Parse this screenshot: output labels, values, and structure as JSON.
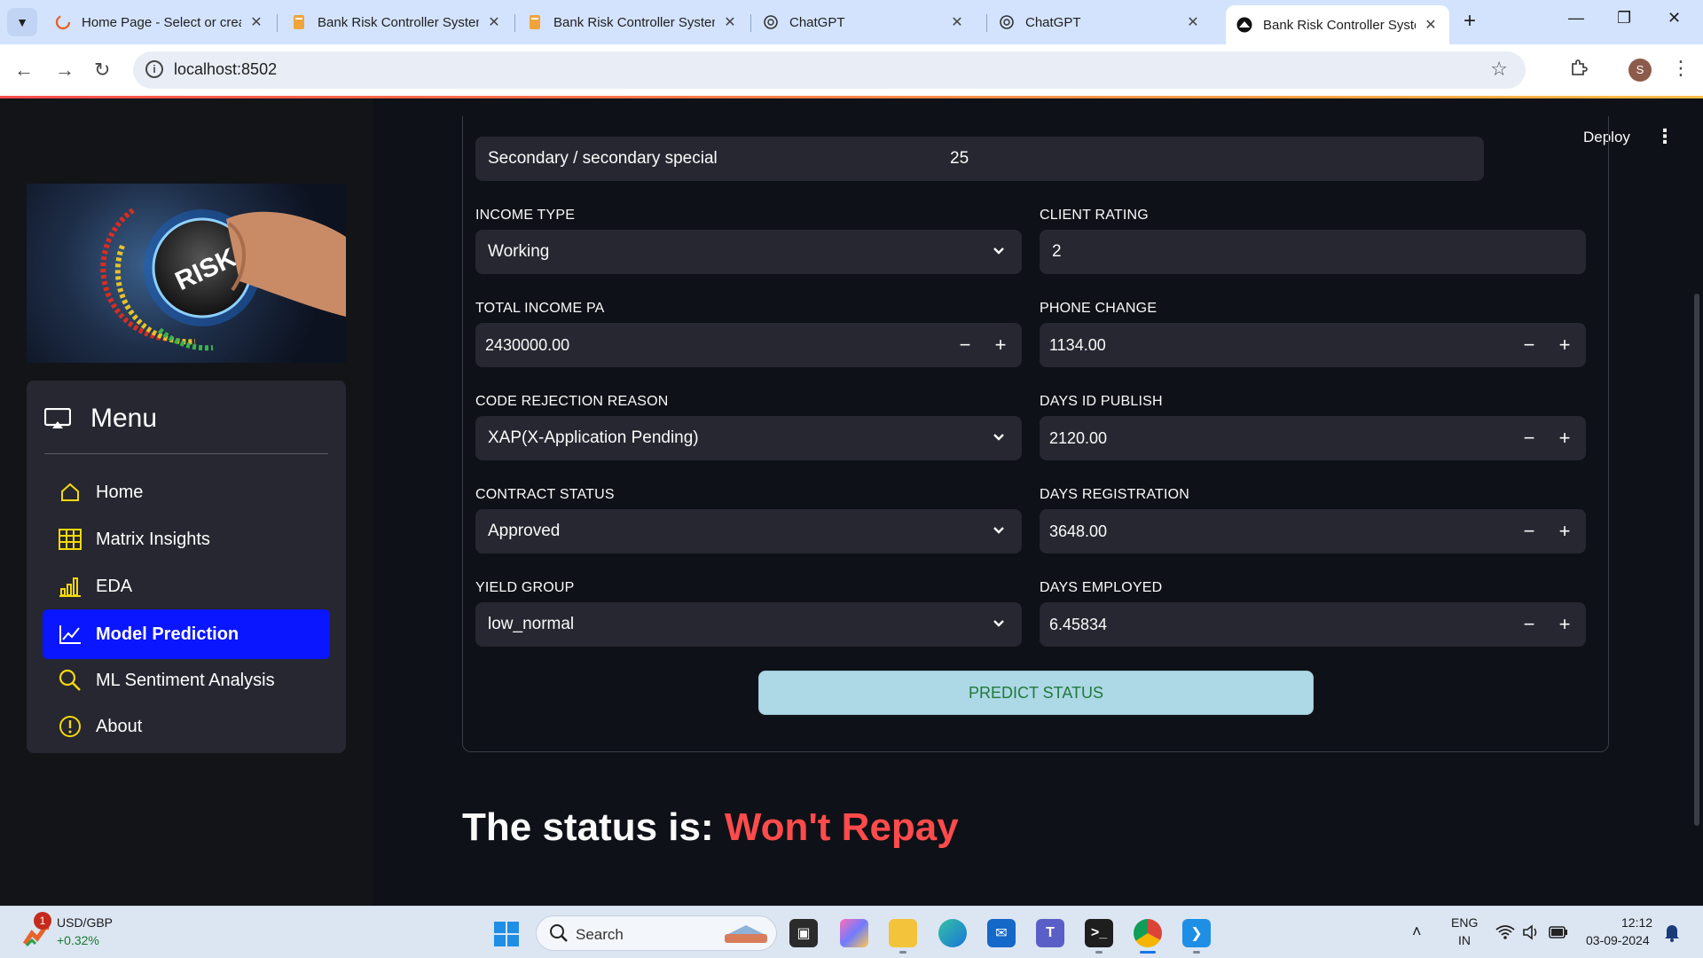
{
  "browser": {
    "tabs": [
      {
        "title": "Home Page - Select or create",
        "favicon": "loading-ring-icon"
      },
      {
        "title": "Bank Risk Controller System",
        "favicon": "notebook-icon"
      },
      {
        "title": "Bank Risk Controller System",
        "favicon": "notebook-icon"
      },
      {
        "title": "ChatGPT",
        "favicon": "openai-icon"
      },
      {
        "title": "ChatGPT",
        "favicon": "openai-icon"
      },
      {
        "title": "Bank Risk Controller System",
        "favicon": "streamlit-icon",
        "active": true
      }
    ],
    "url": "localhost:8502",
    "profile_initial": "S"
  },
  "app": {
    "deploy_label": "Deploy",
    "menu": {
      "title": "Menu",
      "items": [
        {
          "label": "Home",
          "icon": "house-icon"
        },
        {
          "label": "Matrix Insights",
          "icon": "table-grid-icon"
        },
        {
          "label": "EDA",
          "icon": "bar-chart-icon"
        },
        {
          "label": "Model Prediction",
          "icon": "line-chart-icon",
          "active": true
        },
        {
          "label": "ML Sentiment Analysis",
          "icon": "search-icon"
        },
        {
          "label": "About",
          "icon": "exclamation-circle-icon"
        }
      ]
    },
    "form": {
      "education_value": "Secondary / secondary special",
      "age_value": "25",
      "income_type": {
        "label": "INCOME TYPE",
        "value": "Working"
      },
      "client_rating": {
        "label": "CLIENT RATING",
        "value": "2"
      },
      "total_income": {
        "label": "TOTAL INCOME PA",
        "value": "2430000.00"
      },
      "phone_change": {
        "label": "PHONE CHANGE",
        "value": "1134.00"
      },
      "code_rejection": {
        "label": "CODE REJECTION REASON",
        "value": "XAP(X-Application Pending)"
      },
      "days_id_publish": {
        "label": "DAYS ID PUBLISH",
        "value": "2120.00"
      },
      "contract_status": {
        "label": "CONTRACT STATUS",
        "value": "Approved"
      },
      "days_registration": {
        "label": "DAYS REGISTRATION",
        "value": "3648.00"
      },
      "yield_group": {
        "label": "YIELD GROUP",
        "value": "low_normal"
      },
      "days_employed": {
        "label": "DAYS EMPLOYED",
        "value": "6.45834"
      },
      "predict_label": "PREDICT STATUS"
    },
    "result": {
      "prefix": "The status is: ",
      "value": "Won't Repay"
    },
    "colors": {
      "accent": "#ff4b4b",
      "active_menu": "#0a16ff",
      "button": "#add8e6",
      "button_text": "#1f7a3a"
    }
  },
  "taskbar": {
    "weather": {
      "badge": "1",
      "ticker": "USD/GBP",
      "change": "+0.32%"
    },
    "search_placeholder": "Search",
    "tray": {
      "lang": "ENG",
      "region": "IN",
      "time": "12:12",
      "date": "03-09-2024"
    }
  }
}
